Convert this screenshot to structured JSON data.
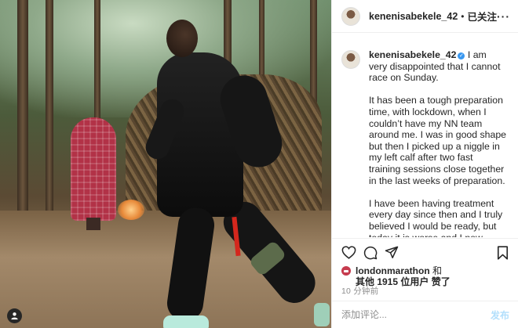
{
  "header": {
    "username": "kenenisabekele_42",
    "separator": "•",
    "follow_status": "已关注",
    "more_icon": "more-horizontal-icon"
  },
  "caption": {
    "username": "kenenisabekele_42",
    "verified_icon": "verified-badge-icon",
    "paragraphs": [
      "I am very disappointed that I cannot race on Sunday.",
      "It has been a tough preparation time, with lockdown, when I couldn’t have my NN team around me. I was in good shape but then I picked up a niggle in my left calf after two fast training sessions close together in the last weeks of preparation.",
      "I have been having treatment every day since then and I truly believed I would be ready, but today it is worse and I now know I cannot race on it."
    ]
  },
  "actions": {
    "like_icon": "heart-icon",
    "comment_icon": "comment-icon",
    "share_icon": "send-icon",
    "save_icon": "bookmark-icon"
  },
  "likes": {
    "first_user": "londonmarathon",
    "and_text": " 和",
    "others_text": "其他 1915 位用户 赞了"
  },
  "timestamp": "10 分钟前",
  "comment_box": {
    "placeholder": "添加评论...",
    "post_label": "发布"
  },
  "colors": {
    "link_blue": "#3897f0",
    "post_disabled": "#b2dffc",
    "muted": "#8e8e8e",
    "text": "#262626"
  }
}
